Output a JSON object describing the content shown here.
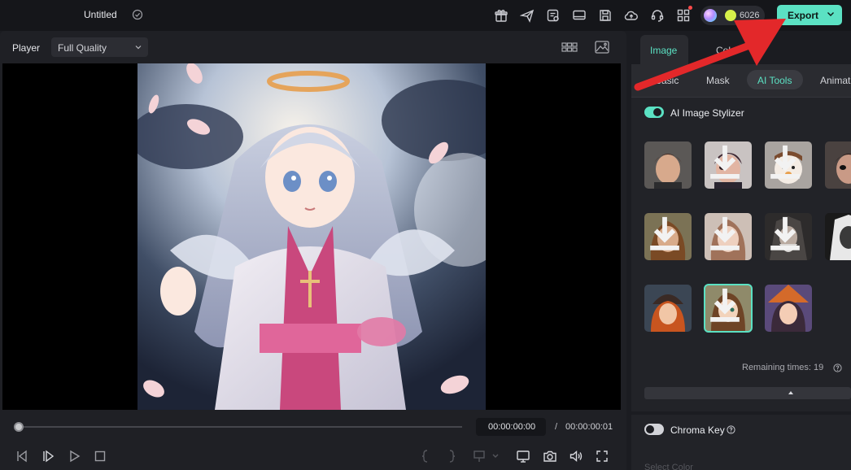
{
  "app": {
    "title": "Untitled",
    "credits": "6026",
    "export_label": "Export"
  },
  "topbar_icons": [
    "gift-icon",
    "send-icon",
    "project-icon",
    "display-icon",
    "save-icon",
    "cloud-icon",
    "support-icon",
    "apps-icon"
  ],
  "player": {
    "label": "Player",
    "quality": "Full Quality",
    "time_current": "00:00:00:00",
    "time_separator": "/",
    "time_total": "00:00:00:01",
    "progress": 0
  },
  "panel": {
    "tabs": [
      {
        "label": "Image",
        "active": true
      },
      {
        "label": "Color",
        "active": false
      }
    ],
    "subtabs": [
      {
        "label": "Basic",
        "active": false
      },
      {
        "label": "Mask",
        "active": false
      },
      {
        "label": "AI Tools",
        "active": true
      },
      {
        "label": "Animation",
        "active": false
      }
    ],
    "stylizer": {
      "title": "AI Image Stylizer",
      "enabled": true,
      "remaining": "Remaining times: 19"
    },
    "chroma": {
      "title": "Chroma Key",
      "enabled": false,
      "select_color": "Select Color"
    }
  },
  "colors": {
    "accent": "#5be1c3",
    "background": "#1b1c21",
    "topbar": "#15161a",
    "annotation_arrow": "#e3282a"
  }
}
